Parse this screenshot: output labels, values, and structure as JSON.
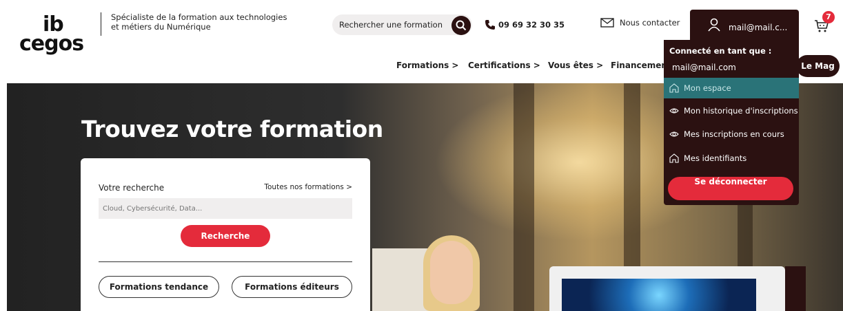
{
  "logo": {
    "line1": "ib",
    "line2": "cegos"
  },
  "tagline": {
    "line1": "Spécialiste de la formation aux technologies",
    "line2": "et métiers du Numérique"
  },
  "search": {
    "placeholder": "Rechercher une formation"
  },
  "phone": "09 69 32 30 35",
  "contact": "Nous contacter",
  "account": {
    "email": "mail@mail.c..."
  },
  "cart": {
    "count": "7"
  },
  "nav": {
    "items": [
      "Formations >",
      "Certifications >",
      "Vous êtes >",
      "Financement"
    ],
    "mag": "Le Mag"
  },
  "hero": {
    "title": "Trouvez votre formation"
  },
  "card": {
    "label": "Votre recherche",
    "all_link": "Toutes nos formations >",
    "input_placeholder": "Cloud, Cybersécurité, Data...",
    "button": "Recherche",
    "pill1": "Formations tendance",
    "pill2": "Formations éditeurs"
  },
  "dropdown": {
    "header": "Connecté en tant que :",
    "email": "mail@mail.com",
    "items": [
      {
        "label": "Mon espace",
        "icon": "home-icon"
      },
      {
        "label": "Mon historique d'inscriptions",
        "icon": "eye-icon"
      },
      {
        "label": "Mes inscriptions en cours",
        "icon": "eye-icon"
      },
      {
        "label": "Mes identifiants",
        "icon": "home-icon"
      }
    ],
    "logout": "Se déconnecter"
  },
  "colors": {
    "brand_dark": "#2b1111",
    "accent_red": "#e42b3b",
    "active_teal": "#2a7378"
  }
}
